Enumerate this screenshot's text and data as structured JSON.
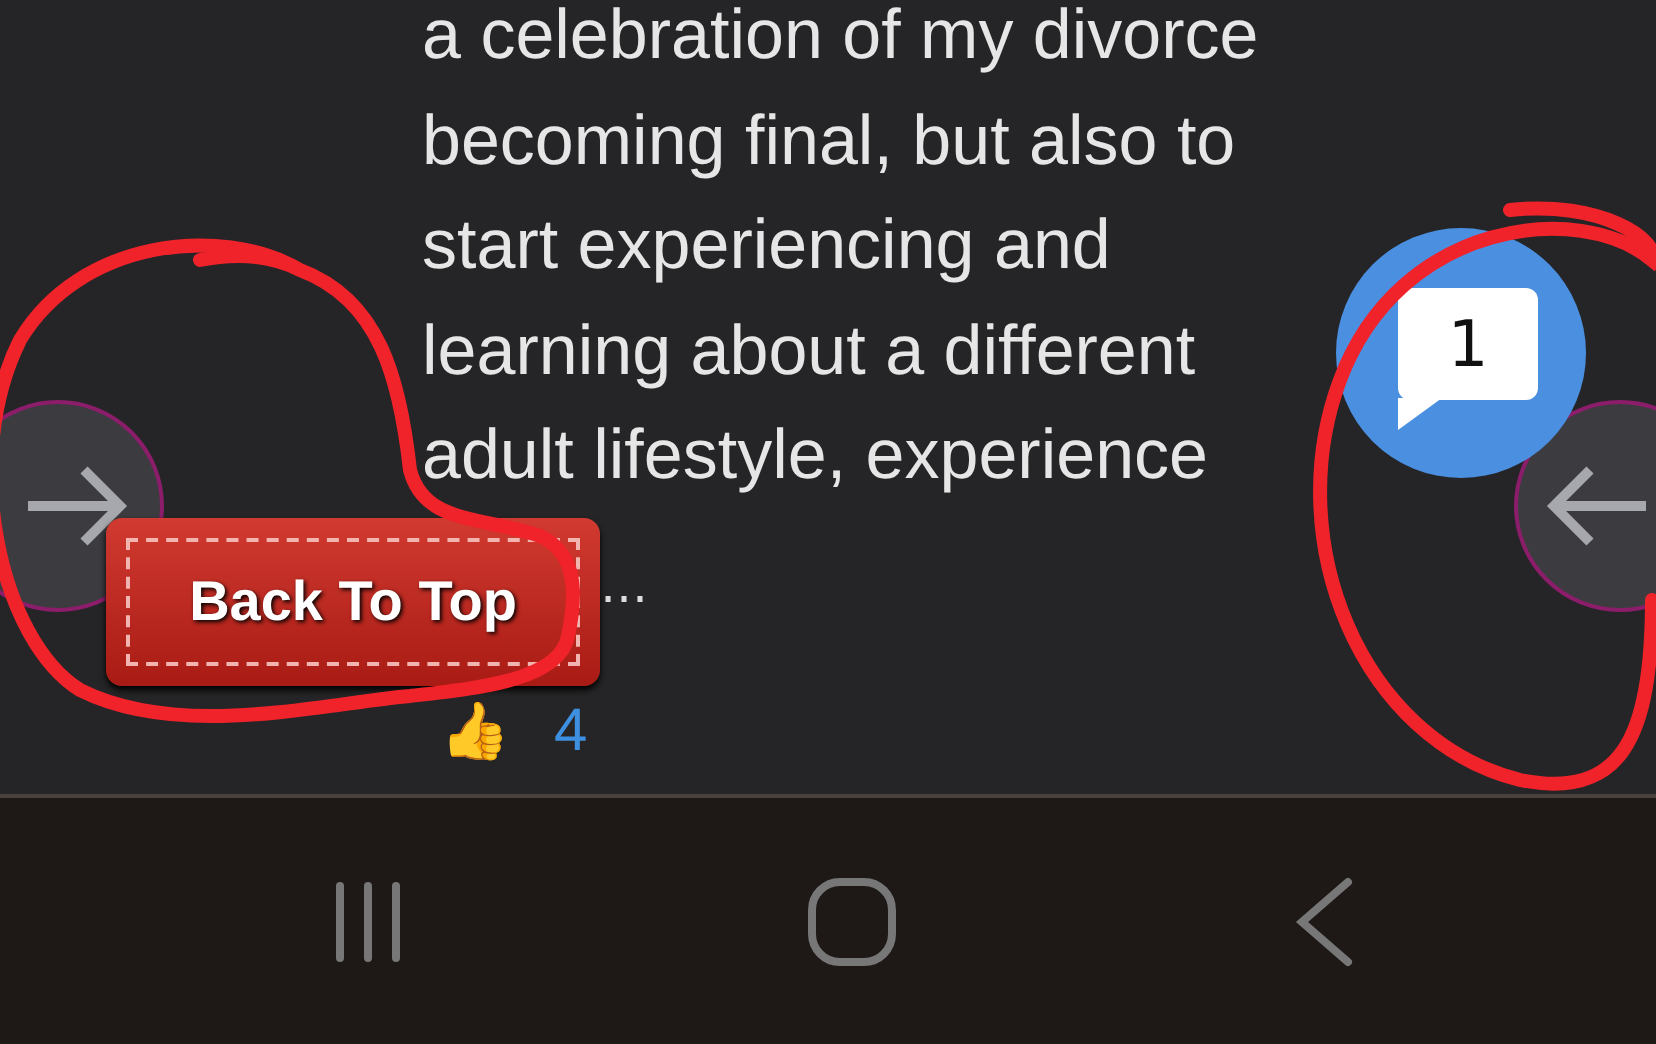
{
  "post": {
    "lines": [
      "a celebration of my divorce",
      "becoming final, but also to",
      "start experiencing and",
      "learning about a different",
      "adult lifestyle, experience"
    ],
    "more": "…",
    "likes": {
      "emoji": "👍",
      "count": "4"
    }
  },
  "back_to_top": {
    "label": "Back To Top"
  },
  "chat": {
    "count": "1"
  },
  "nav": [
    {
      "kind": "recents"
    },
    {
      "kind": "home"
    },
    {
      "kind": "back"
    }
  ]
}
